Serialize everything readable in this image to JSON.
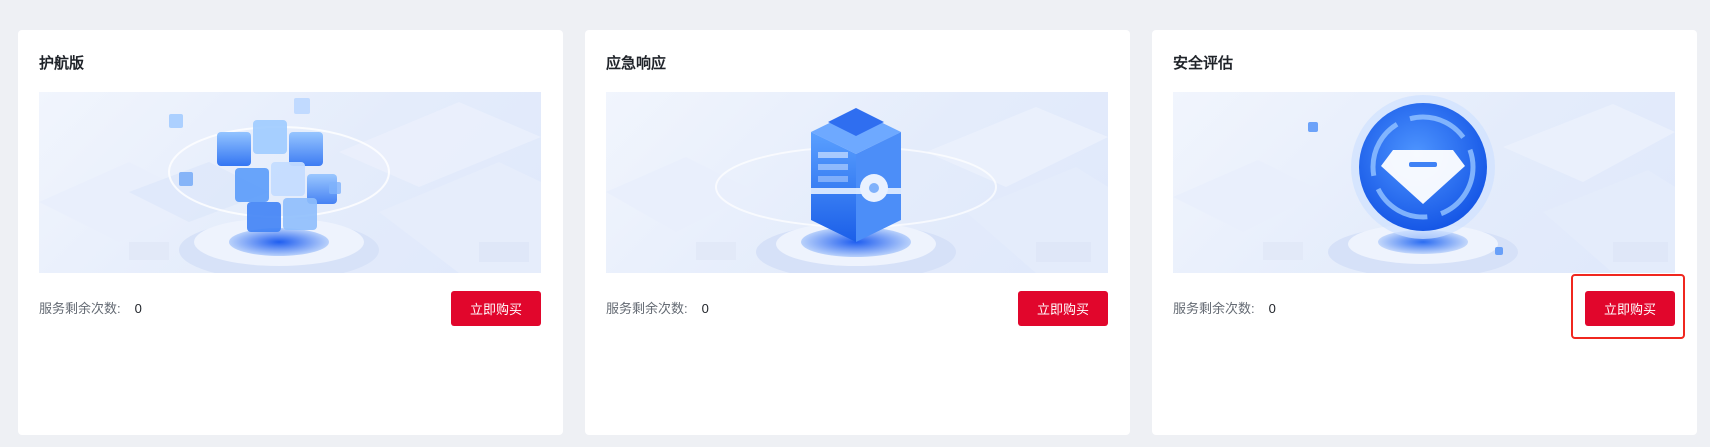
{
  "cards": [
    {
      "title": "护航版",
      "remaining_label": "服务剩余次数:",
      "remaining_count": "0",
      "button_label": "立即购买",
      "illustration": "cube-cluster-illustration"
    },
    {
      "title": "应急响应",
      "remaining_label": "服务剩余次数:",
      "remaining_count": "0",
      "button_label": "立即购买",
      "illustration": "server-box-illustration"
    },
    {
      "title": "安全评估",
      "remaining_label": "服务剩余次数:",
      "remaining_count": "0",
      "button_label": "立即购买",
      "illustration": "diamond-badge-illustration"
    }
  ],
  "colors": {
    "page_background": "#eef0f4",
    "card_background": "#ffffff",
    "button": "#e1062c",
    "highlight_border": "#f0271f",
    "illustration_blue": "#2f7cf6"
  }
}
